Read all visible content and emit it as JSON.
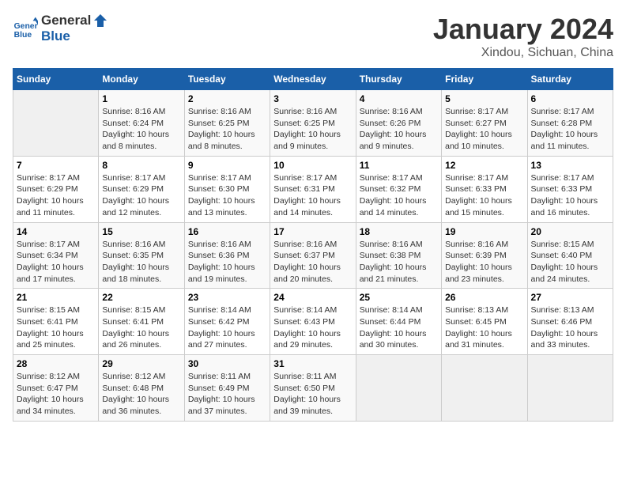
{
  "header": {
    "logo_line1": "General",
    "logo_line2": "Blue",
    "month": "January 2024",
    "location": "Xindou, Sichuan, China"
  },
  "weekdays": [
    "Sunday",
    "Monday",
    "Tuesday",
    "Wednesday",
    "Thursday",
    "Friday",
    "Saturday"
  ],
  "weeks": [
    [
      {
        "day": "",
        "info": ""
      },
      {
        "day": "1",
        "info": "Sunrise: 8:16 AM\nSunset: 6:24 PM\nDaylight: 10 hours\nand 8 minutes."
      },
      {
        "day": "2",
        "info": "Sunrise: 8:16 AM\nSunset: 6:25 PM\nDaylight: 10 hours\nand 8 minutes."
      },
      {
        "day": "3",
        "info": "Sunrise: 8:16 AM\nSunset: 6:25 PM\nDaylight: 10 hours\nand 9 minutes."
      },
      {
        "day": "4",
        "info": "Sunrise: 8:16 AM\nSunset: 6:26 PM\nDaylight: 10 hours\nand 9 minutes."
      },
      {
        "day": "5",
        "info": "Sunrise: 8:17 AM\nSunset: 6:27 PM\nDaylight: 10 hours\nand 10 minutes."
      },
      {
        "day": "6",
        "info": "Sunrise: 8:17 AM\nSunset: 6:28 PM\nDaylight: 10 hours\nand 11 minutes."
      }
    ],
    [
      {
        "day": "7",
        "info": "Sunrise: 8:17 AM\nSunset: 6:29 PM\nDaylight: 10 hours\nand 11 minutes."
      },
      {
        "day": "8",
        "info": "Sunrise: 8:17 AM\nSunset: 6:29 PM\nDaylight: 10 hours\nand 12 minutes."
      },
      {
        "day": "9",
        "info": "Sunrise: 8:17 AM\nSunset: 6:30 PM\nDaylight: 10 hours\nand 13 minutes."
      },
      {
        "day": "10",
        "info": "Sunrise: 8:17 AM\nSunset: 6:31 PM\nDaylight: 10 hours\nand 14 minutes."
      },
      {
        "day": "11",
        "info": "Sunrise: 8:17 AM\nSunset: 6:32 PM\nDaylight: 10 hours\nand 14 minutes."
      },
      {
        "day": "12",
        "info": "Sunrise: 8:17 AM\nSunset: 6:33 PM\nDaylight: 10 hours\nand 15 minutes."
      },
      {
        "day": "13",
        "info": "Sunrise: 8:17 AM\nSunset: 6:33 PM\nDaylight: 10 hours\nand 16 minutes."
      }
    ],
    [
      {
        "day": "14",
        "info": "Sunrise: 8:17 AM\nSunset: 6:34 PM\nDaylight: 10 hours\nand 17 minutes."
      },
      {
        "day": "15",
        "info": "Sunrise: 8:16 AM\nSunset: 6:35 PM\nDaylight: 10 hours\nand 18 minutes."
      },
      {
        "day": "16",
        "info": "Sunrise: 8:16 AM\nSunset: 6:36 PM\nDaylight: 10 hours\nand 19 minutes."
      },
      {
        "day": "17",
        "info": "Sunrise: 8:16 AM\nSunset: 6:37 PM\nDaylight: 10 hours\nand 20 minutes."
      },
      {
        "day": "18",
        "info": "Sunrise: 8:16 AM\nSunset: 6:38 PM\nDaylight: 10 hours\nand 21 minutes."
      },
      {
        "day": "19",
        "info": "Sunrise: 8:16 AM\nSunset: 6:39 PM\nDaylight: 10 hours\nand 23 minutes."
      },
      {
        "day": "20",
        "info": "Sunrise: 8:15 AM\nSunset: 6:40 PM\nDaylight: 10 hours\nand 24 minutes."
      }
    ],
    [
      {
        "day": "21",
        "info": "Sunrise: 8:15 AM\nSunset: 6:41 PM\nDaylight: 10 hours\nand 25 minutes."
      },
      {
        "day": "22",
        "info": "Sunrise: 8:15 AM\nSunset: 6:41 PM\nDaylight: 10 hours\nand 26 minutes."
      },
      {
        "day": "23",
        "info": "Sunrise: 8:14 AM\nSunset: 6:42 PM\nDaylight: 10 hours\nand 27 minutes."
      },
      {
        "day": "24",
        "info": "Sunrise: 8:14 AM\nSunset: 6:43 PM\nDaylight: 10 hours\nand 29 minutes."
      },
      {
        "day": "25",
        "info": "Sunrise: 8:14 AM\nSunset: 6:44 PM\nDaylight: 10 hours\nand 30 minutes."
      },
      {
        "day": "26",
        "info": "Sunrise: 8:13 AM\nSunset: 6:45 PM\nDaylight: 10 hours\nand 31 minutes."
      },
      {
        "day": "27",
        "info": "Sunrise: 8:13 AM\nSunset: 6:46 PM\nDaylight: 10 hours\nand 33 minutes."
      }
    ],
    [
      {
        "day": "28",
        "info": "Sunrise: 8:12 AM\nSunset: 6:47 PM\nDaylight: 10 hours\nand 34 minutes."
      },
      {
        "day": "29",
        "info": "Sunrise: 8:12 AM\nSunset: 6:48 PM\nDaylight: 10 hours\nand 36 minutes."
      },
      {
        "day": "30",
        "info": "Sunrise: 8:11 AM\nSunset: 6:49 PM\nDaylight: 10 hours\nand 37 minutes."
      },
      {
        "day": "31",
        "info": "Sunrise: 8:11 AM\nSunset: 6:50 PM\nDaylight: 10 hours\nand 39 minutes."
      },
      {
        "day": "",
        "info": ""
      },
      {
        "day": "",
        "info": ""
      },
      {
        "day": "",
        "info": ""
      }
    ]
  ]
}
